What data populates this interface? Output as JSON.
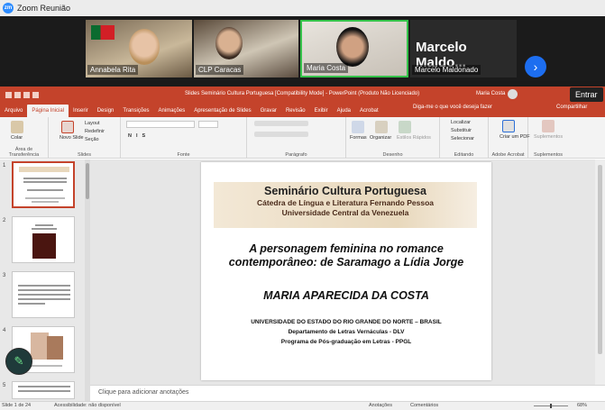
{
  "zoom": {
    "window_title": "Zoom Reunião",
    "participants": [
      {
        "name": "Annabela Rita"
      },
      {
        "name": "CLP Caracas"
      },
      {
        "name": "Maria Costa"
      },
      {
        "name": "Marcelo Maldonado",
        "large_label": "Marcelo Maldo..."
      }
    ],
    "entrar_label": "Entrar"
  },
  "ppt": {
    "title": "Slides Seminário Cultura Portuguesa [Compatibility Mode] - PowerPoint (Produto Não Licenciado)",
    "user": "Maria Costa",
    "tabs": [
      "Arquivo",
      "Página Inicial",
      "Inserir",
      "Design",
      "Transições",
      "Animações",
      "Apresentação de Slides",
      "Gravar",
      "Revisão",
      "Exibir",
      "Ajuda",
      "Acrobat"
    ],
    "active_tab": "Página Inicial",
    "tell_me": "Diga-me o que você deseja fazer",
    "share": "Compartilhar",
    "ribbon": {
      "colar": "Colar",
      "novo_slide": "Novo Slide",
      "layout": "Layout",
      "redefinir": "Redefinir",
      "secao": "Seção",
      "formas": "Formas",
      "organizar": "Organizar",
      "estilos": "Estilos Rápidos",
      "localizar": "Localizar",
      "substituir": "Substituir",
      "selecionar": "Selecionar",
      "criar_pdf": "Criar um PDF",
      "suplementos": "Suplementos",
      "groups": {
        "clipboard": "Área de Transferência",
        "slides": "Slides",
        "fonte": "Fonte",
        "paragrafo": "Parágrafo",
        "desenho": "Desenho",
        "editando": "Editando",
        "acrobat": "Adobe Acrobat",
        "suplementos": "Suplementos"
      }
    },
    "thumb_numbers": [
      "1",
      "2",
      "3",
      "4",
      "5"
    ],
    "slide": {
      "title": "Seminário Cultura Portuguesa",
      "subtitle1": "Cátedra de Língua e Literatura Fernando Pessoa",
      "subtitle2": "Universidade Central da Venezuela",
      "heading1": "A personagem feminina no romance",
      "heading2": "contemporâneo: de Saramago a Lídia Jorge",
      "author": "MARIA APARECIDA DA COSTA",
      "inst1": "UNIVERSIDADE DO ESTADO DO RIO GRANDE DO NORTE – BRASIL",
      "inst2": "Departamento de Letras Vernáculas - DLV",
      "inst3": "Programa de Pós-graduação em Letras  - PPGL"
    },
    "notes_placeholder": "Clique para adicionar anotações",
    "status": {
      "slide_count": "Slide 1 de 24",
      "accessibility": "Acessibilidade: não disponível",
      "anotacoes": "Anotações",
      "comentarios": "Comentários",
      "zoom": "68%"
    }
  }
}
